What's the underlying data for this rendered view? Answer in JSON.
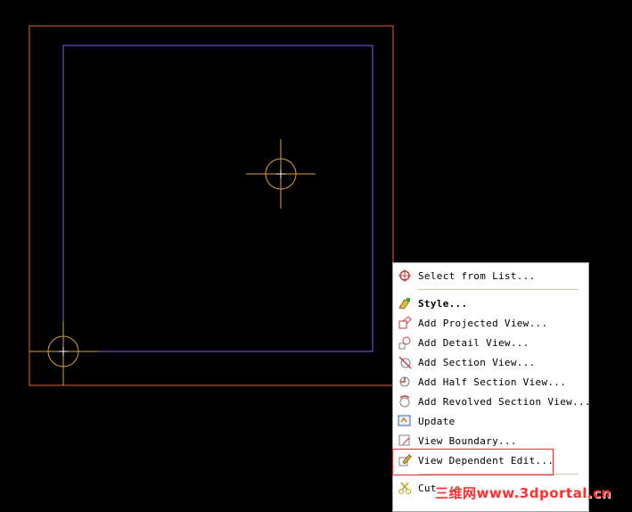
{
  "context_menu": {
    "items": [
      {
        "label": "Select from List...",
        "icon": "select-from-list-icon"
      },
      {
        "label": "Style...",
        "icon": "style-icon",
        "bold": true
      },
      {
        "label": "Add Projected View...",
        "icon": "projected-view-icon"
      },
      {
        "label": "Add Detail View...",
        "icon": "detail-view-icon"
      },
      {
        "label": "Add Section View...",
        "icon": "section-view-icon"
      },
      {
        "label": "Add Half Section View...",
        "icon": "half-section-view-icon"
      },
      {
        "label": "Add Revolved Section View...",
        "icon": "revolved-section-view-icon"
      },
      {
        "label": "Update",
        "icon": "update-icon"
      },
      {
        "label": "View Boundary...",
        "icon": "view-boundary-icon"
      },
      {
        "label": "View Dependent Edit...",
        "icon": "view-dependent-edit-icon"
      },
      {
        "label": "Cut",
        "icon": "cut-icon"
      }
    ]
  },
  "watermark": "三维网www.3dportal.cn",
  "colors": {
    "outer_border": "#e8603c",
    "inner_border": "#8a5cf0",
    "crosshair": "#d8a040",
    "highlight": "#e03030"
  }
}
